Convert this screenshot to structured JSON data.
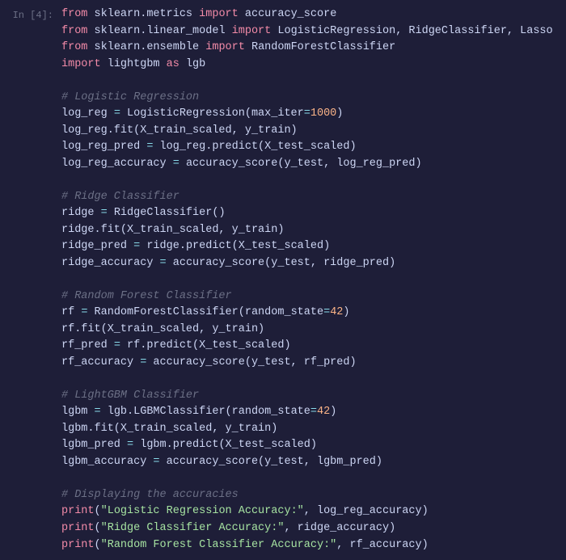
{
  "cell": {
    "prompt": "In [4]:",
    "code": {
      "line1": {
        "kw1": "from",
        "mod": "sklearn.metrics",
        "kw2": "import",
        "names": "accuracy_score"
      },
      "line2": {
        "kw1": "from",
        "mod": "sklearn.linear_model",
        "kw2": "import",
        "names": "LogisticRegression, RidgeClassifier, Lasso"
      },
      "line3": {
        "kw1": "from",
        "mod": "sklearn.ensemble",
        "kw2": "import",
        "names": "RandomForestClassifier"
      },
      "line4": {
        "kw1": "import",
        "mod": "lightgbm",
        "kw2": "as",
        "alias": "lgb"
      },
      "cmt1": "# Logistic Regression",
      "l5a": "log_reg ",
      "l5eq": "=",
      "l5b": " LogisticRegression(max_iter",
      "l5eq2": "=",
      "l5num": "1000",
      "l5c": ")",
      "l6": "log_reg.fit(X_train_scaled, y_train)",
      "l7a": "log_reg_pred ",
      "l7eq": "=",
      "l7b": " log_reg.predict(X_test_scaled)",
      "l8a": "log_reg_accuracy ",
      "l8eq": "=",
      "l8b": " accuracy_score(y_test, log_reg_pred)",
      "cmt2": "# Ridge Classifier",
      "l9a": "ridge ",
      "l9eq": "=",
      "l9b": " RidgeClassifier()",
      "l10": "ridge.fit(X_train_scaled, y_train)",
      "l11a": "ridge_pred ",
      "l11eq": "=",
      "l11b": " ridge.predict(X_test_scaled)",
      "l12a": "ridge_accuracy ",
      "l12eq": "=",
      "l12b": " accuracy_score(y_test, ridge_pred)",
      "cmt3": "# Random Forest Classifier",
      "l13a": "rf ",
      "l13eq": "=",
      "l13b": " RandomForestClassifier(random_state",
      "l13eq2": "=",
      "l13num": "42",
      "l13c": ")",
      "l14": "rf.fit(X_train_scaled, y_train)",
      "l15a": "rf_pred ",
      "l15eq": "=",
      "l15b": " rf.predict(X_test_scaled)",
      "l16a": "rf_accuracy ",
      "l16eq": "=",
      "l16b": " accuracy_score(y_test, rf_pred)",
      "cmt4": "# LightGBM Classifier",
      "l17a": "lgbm ",
      "l17eq": "=",
      "l17b": " lgb.LGBMClassifier(random_state",
      "l17eq2": "=",
      "l17num": "42",
      "l17c": ")",
      "l18": "lgbm.fit(X_train_scaled, y_train)",
      "l19a": "lgbm_pred ",
      "l19eq": "=",
      "l19b": " lgbm.predict(X_test_scaled)",
      "l20a": "lgbm_accuracy ",
      "l20eq": "=",
      "l20b": " accuracy_score(y_test, lgbm_pred)",
      "cmt5": "# Displaying the accuracies",
      "p1kw": "print",
      "p1a": "(",
      "p1s": "\"Logistic Regression Accuracy:\"",
      "p1b": ", log_reg_accuracy)",
      "p2kw": "print",
      "p2a": "(",
      "p2s": "\"Ridge Classifier Accuracy:\"",
      "p2b": ", ridge_accuracy)",
      "p3kw": "print",
      "p3a": "(",
      "p3s": "\"Random Forest Classifier Accuracy:\"",
      "p3b": ", rf_accuracy)"
    }
  }
}
